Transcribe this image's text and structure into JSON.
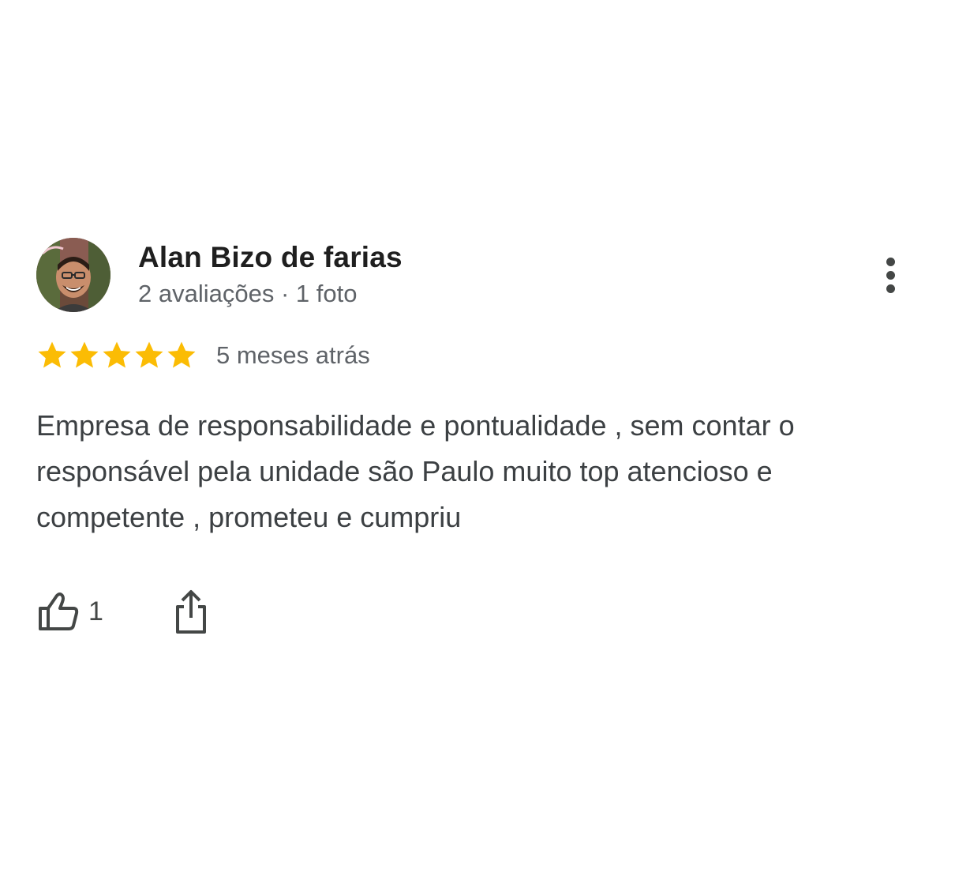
{
  "review": {
    "reviewer_name": "Alan Bizo de farias",
    "reviewer_reviews": "2 avaliações",
    "separator": "·",
    "reviewer_photos": "1 foto",
    "rating": 5,
    "rating_max": 5,
    "date": "5 meses atrás",
    "text": "Empresa de responsabilidade e pontualidade , sem contar o responsável pela unidade são Paulo muito top atencioso e competente , prometeu e cumpriu",
    "likes": "1"
  },
  "icons": {
    "more": "more-vert-icon",
    "star": "star-icon",
    "like": "thumb-up-icon",
    "share": "share-icon"
  },
  "colors": {
    "star": "#FBBC04",
    "name": "#1f1f1f",
    "meta": "#5f6368",
    "body": "#3c4043",
    "icon": "#444746"
  }
}
